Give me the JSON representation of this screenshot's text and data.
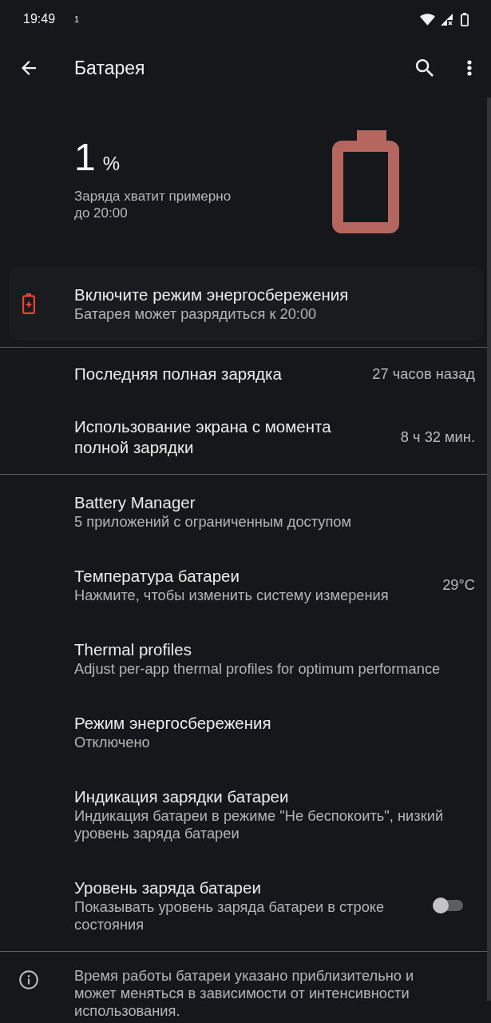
{
  "status_bar": {
    "time": "19:49",
    "notification_count": "1"
  },
  "app_bar": {
    "title": "Батарея"
  },
  "battery_summary": {
    "percent": "1",
    "unit": "%",
    "estimate": "Заряда хватит примерно до 20:00"
  },
  "suggestion_card": {
    "title": "Включите режим энергосбережения",
    "summary": "Батарея может разрядиться к 20:00"
  },
  "usage": [
    {
      "title": "Последняя полная зарядка",
      "value": "27 часов назад"
    },
    {
      "title": "Использование экрана с момента полной зарядки",
      "value": "8 ч 32 мин."
    }
  ],
  "settings": [
    {
      "kind": "plain",
      "title": "Battery Manager",
      "summary": "5 приложений с ограниченным доступом"
    },
    {
      "kind": "value",
      "title": "Температура батареи",
      "summary": "Нажмите, чтобы изменить систему измерения",
      "value": "29°C"
    },
    {
      "kind": "plain",
      "title": "Thermal profiles",
      "summary": "Adjust per-app thermal profiles for optimum performance"
    },
    {
      "kind": "plain",
      "title": "Режим энергосбережения",
      "summary": "Отключено"
    },
    {
      "kind": "plain",
      "title": "Индикация зарядки батареи",
      "summary": "Индикация батареи в режиме \"Не беспокоить\", низкий уровень заряда батареи"
    },
    {
      "kind": "switch",
      "title": "Уровень заряда батареи",
      "summary": "Показывать уровень заряда батареи в строке состояния",
      "on": false
    }
  ],
  "footer": {
    "note": "Время работы батареи указано приблизительно и может меняться в зависимости от интенсивности использования."
  }
}
